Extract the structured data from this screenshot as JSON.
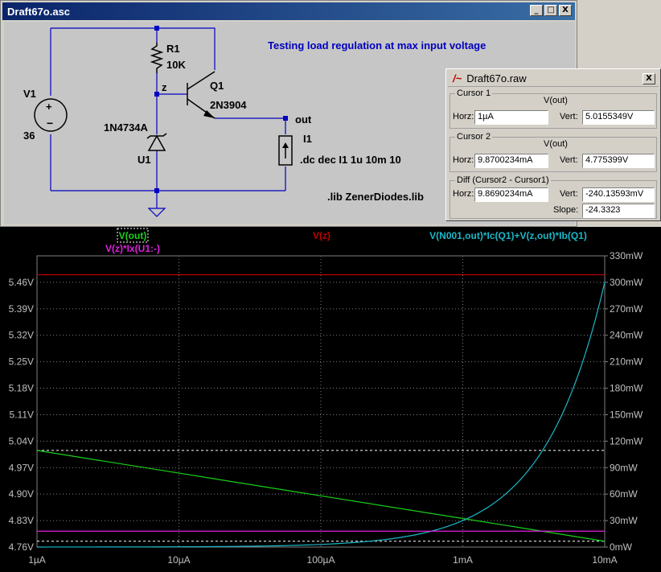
{
  "schematic_window": {
    "title": "Draft67o.asc",
    "btn_minimize": "_",
    "btn_restore": "□",
    "btn_close": "X",
    "labels": {
      "r1_name": "R1",
      "r1_value": "10K",
      "node_z": "z",
      "q1_name": "Q1",
      "q1_model": "2N3904",
      "v1_name": "V1",
      "v1_value": "36",
      "diode_model": "1N4734A",
      "u1_name": "U1",
      "node_out": "out",
      "i1_name": "I1",
      "dc_cmd": ".dc dec I1 1u 10m 10",
      "lib_cmd": ".lib ZenerDiodes.lib",
      "comment": "Testing load regulation at max input voltage"
    }
  },
  "raw_window": {
    "title": "Draft67o.raw",
    "btn_close": "X",
    "cursor1": {
      "title": "Cursor 1",
      "trace": "V(out)",
      "horz_label": "Horz:",
      "vert_label": "Vert:",
      "horz": "1µA",
      "vert": "5.0155349V"
    },
    "cursor2": {
      "title": "Cursor 2",
      "trace": "V(out)",
      "horz_label": "Horz:",
      "vert_label": "Vert:",
      "horz": "9.8700234mA",
      "vert": "4.775399V"
    },
    "diff": {
      "title": "Diff (Cursor2 - Cursor1)",
      "horz_label": "Horz:",
      "vert_label": "Vert:",
      "slope_label": "Slope:",
      "horz": "9.8690234mA",
      "vert": "-240.13593mV",
      "slope": "-24.3323"
    }
  },
  "colors": {
    "v_out": "#19d219",
    "v_z": "#c00000",
    "power_q1": "#1ab8c8",
    "power_u1": "#e020e0",
    "grid": "#808080",
    "axis_text": "#c0c0c0"
  },
  "chart_data": {
    "type": "line",
    "x_scale": "log",
    "xlim": [
      1e-06,
      0.01
    ],
    "x_tick_labels": [
      "1µA",
      "10µA",
      "100µA",
      "1mA",
      "10mA"
    ],
    "x_tick_values": [
      1e-06,
      1e-05,
      0.0001,
      0.001,
      0.01
    ],
    "y_left_lim": [
      4.76,
      5.53
    ],
    "y_left_ticks": [
      4.76,
      4.83,
      4.9,
      4.97,
      5.04,
      5.11,
      5.18,
      5.25,
      5.32,
      5.39,
      5.46
    ],
    "y_left_tick_labels": [
      "4.76V",
      "4.83V",
      "4.90V",
      "4.97V",
      "5.04V",
      "5.11V",
      "5.18V",
      "5.25V",
      "5.32V",
      "5.39V",
      "5.46V"
    ],
    "y_right_lim": [
      0,
      330
    ],
    "y_right_ticks": [
      0,
      30,
      60,
      90,
      120,
      150,
      180,
      210,
      240,
      270,
      300,
      330
    ],
    "y_right_tick_labels": [
      "0mW",
      "30mW",
      "60mW",
      "90mW",
      "120mW",
      "150mW",
      "180mW",
      "210mW",
      "240mW",
      "270mW",
      "300mW",
      "330mW"
    ],
    "grid": true,
    "cursor_lines": {
      "y_left": [
        5.0155349,
        4.775399
      ],
      "x": [
        1e-06,
        0.0098700234
      ]
    },
    "series": [
      {
        "name": "V(out)",
        "axis": "left",
        "x": [
          1e-06,
          1e-05,
          0.0001,
          0.001,
          0.01
        ],
        "y": [
          5.0155,
          4.9555,
          4.8955,
          4.8355,
          4.7754
        ]
      },
      {
        "name": "V(z)",
        "axis": "left",
        "x": [
          1e-06,
          0.01
        ],
        "y": [
          5.48,
          5.48
        ]
      },
      {
        "name": "V(N001,out)*Ic(Q1)+V(z,out)*Ib(Q1)",
        "axis": "right",
        "x": [
          1e-06,
          1e-05,
          0.0001,
          0.0003,
          0.001,
          0.002,
          0.003,
          0.005,
          0.007,
          0.01
        ],
        "y": [
          0.03,
          0.3,
          3,
          9,
          30,
          60,
          90,
          150,
          210,
          300
        ]
      },
      {
        "name": "V(z)*Ix(U1:-)",
        "axis": "right",
        "x": [
          1e-06,
          0.01
        ],
        "y": [
          18,
          18
        ]
      }
    ]
  }
}
